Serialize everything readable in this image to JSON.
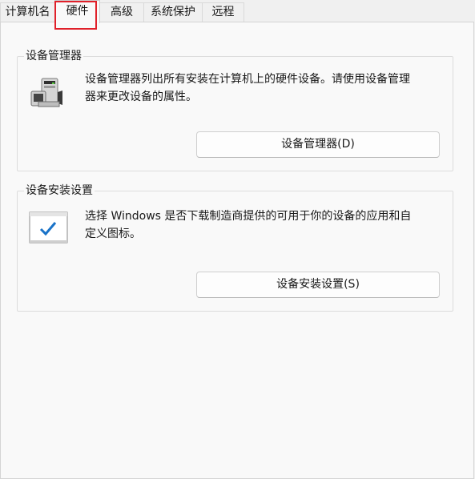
{
  "tabs": [
    {
      "label": "计算机名"
    },
    {
      "label": "硬件"
    },
    {
      "label": "高级"
    },
    {
      "label": "系统保护"
    },
    {
      "label": "远程"
    }
  ],
  "active_tab": "硬件",
  "device_manager": {
    "title": "设备管理器",
    "description_line1": "设备管理器列出所有安装在计算机上的硬件设备。请使用设备管理",
    "description_line2": "器来更改设备的属性。",
    "button_label": "设备管理器(D)",
    "icon": "device-manager-icon"
  },
  "device_install": {
    "title": "设备安装设置",
    "description_line1": "选择 Windows 是否下载制造商提供的可用于你的设备的应用和自",
    "description_line2": "定义图标。",
    "button_label": "设备安装设置(S)",
    "icon": "checkbox-window-icon"
  },
  "colors": {
    "highlight": "#e0202a",
    "accent": "#1a73c8"
  }
}
